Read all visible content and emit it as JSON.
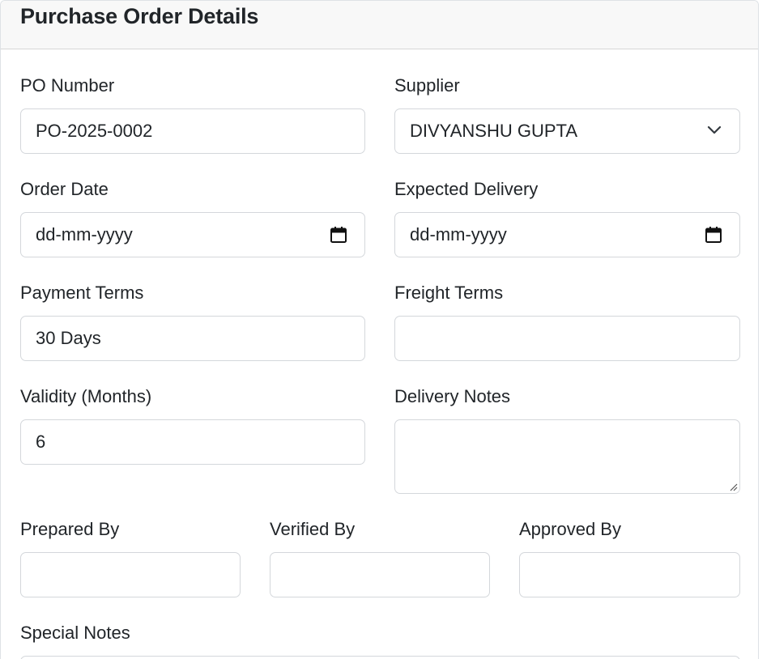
{
  "header": {
    "title": "Purchase Order Details"
  },
  "fields": {
    "po_number": {
      "label": "PO Number",
      "value": "PO-2025-0002"
    },
    "supplier": {
      "label": "Supplier",
      "value": "DIVYANSHU GUPTA"
    },
    "order_date": {
      "label": "Order Date",
      "value": "dd-mm-yyyy"
    },
    "expected_delivery": {
      "label": "Expected Delivery",
      "value": "dd-mm-yyyy"
    },
    "payment_terms": {
      "label": "Payment Terms",
      "value": "30 Days"
    },
    "freight_terms": {
      "label": "Freight Terms",
      "value": ""
    },
    "validity": {
      "label": "Validity (Months)",
      "value": "6"
    },
    "delivery_notes": {
      "label": "Delivery Notes",
      "value": ""
    },
    "prepared_by": {
      "label": "Prepared By",
      "value": ""
    },
    "verified_by": {
      "label": "Verified By",
      "value": ""
    },
    "approved_by": {
      "label": "Approved By",
      "value": ""
    },
    "special_notes": {
      "label": "Special Notes"
    }
  },
  "icons": {
    "dropdown": "chevron-down-icon",
    "date": "calendar-icon"
  }
}
